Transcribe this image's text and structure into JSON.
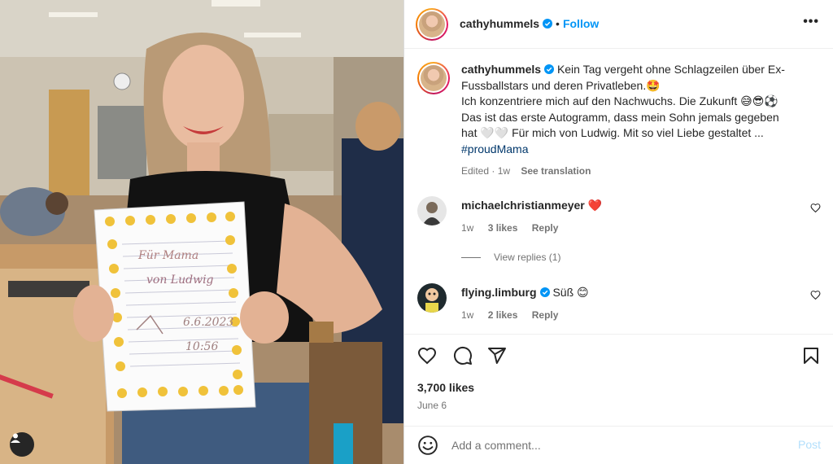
{
  "post": {
    "author": "cathyhummels",
    "follow_label": "Follow",
    "separator": "•",
    "more_label": "•••",
    "caption_lines": [
      "Kein Tag vergeht ohne Schlagzeilen über Ex-",
      "Fussballstars und deren Privatleben.🤩",
      "Ich konzentriere mich auf den Nachwuchs. Die Zukunft 😅😎⚽",
      "Das ist das erste Autogramm, dass mein Sohn jemals gegeben",
      "hat 🤍🤍 Für mich von Ludwig. Mit so viel Liebe gestaltet ..."
    ],
    "hashtag": "#proudMama",
    "caption_meta": {
      "edited": "Edited · 1w",
      "see_translation": "See translation"
    }
  },
  "comments": [
    {
      "user": "michaelchristianmeyer",
      "text": "❤️",
      "time": "1w",
      "likes": "3 likes",
      "reply": "Reply",
      "view_replies": "View replies (1)"
    },
    {
      "user": "flying.limburg",
      "text": "Süß 😊",
      "time": "1w",
      "likes": "2 likes",
      "reply": "Reply"
    }
  ],
  "stats": {
    "likes": "3,700 likes",
    "date": "June 6"
  },
  "composer": {
    "placeholder": "Add a comment...",
    "post_label": "Post"
  },
  "photo": {
    "note_lines": [
      "Für Mama",
      "von Ludwig",
      "6.6.2023",
      "10:56"
    ]
  },
  "colors": {
    "accent": "#0095f6",
    "text": "#262626",
    "muted": "#737373",
    "post_disabled": "#b2dffc"
  },
  "icons": [
    "verified-badge-icon",
    "more-options-icon",
    "heart-icon",
    "comment-icon",
    "share-icon",
    "save-bookmark-icon",
    "emoji-icon",
    "user-tag-icon"
  ]
}
